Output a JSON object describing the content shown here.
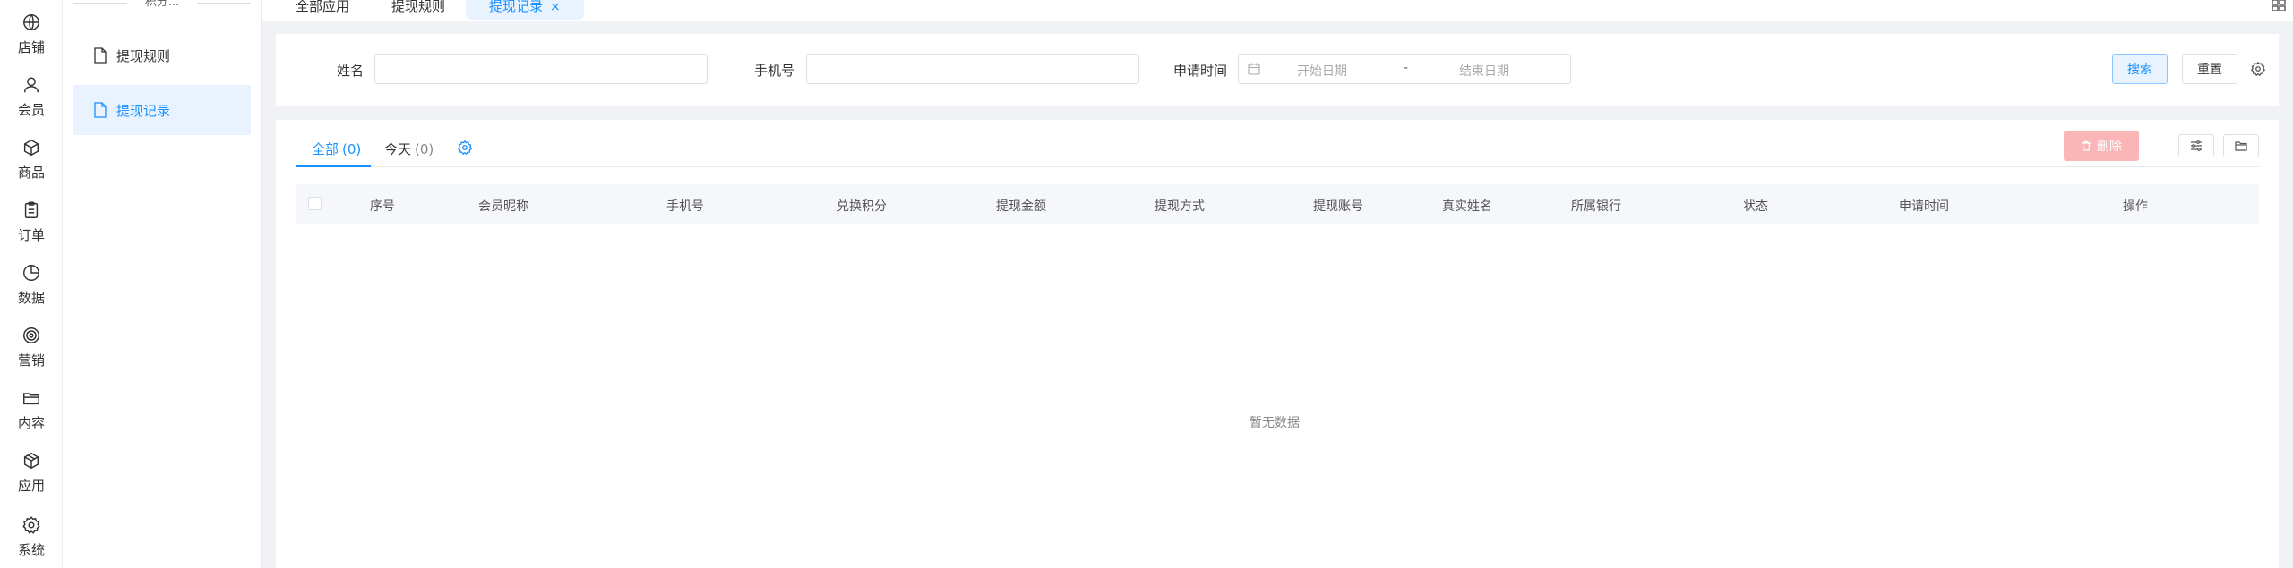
{
  "rail": {
    "items": [
      {
        "label": "店铺",
        "icon": "globe-icon"
      },
      {
        "label": "会员",
        "icon": "user-icon"
      },
      {
        "label": "商品",
        "icon": "cube-icon"
      },
      {
        "label": "订单",
        "icon": "clipboard-icon"
      },
      {
        "label": "数据",
        "icon": "pie-chart-icon"
      },
      {
        "label": "营销",
        "icon": "target-icon"
      },
      {
        "label": "内容",
        "icon": "folder-icon"
      },
      {
        "label": "应用",
        "icon": "box-icon"
      },
      {
        "label": "系统",
        "icon": "gear-icon"
      }
    ]
  },
  "submenu": {
    "heading": "积分...",
    "items": [
      {
        "label": "提现规则"
      },
      {
        "label": "提现记录"
      }
    ]
  },
  "tabs": [
    {
      "label": "全部应用"
    },
    {
      "label": "提现规则"
    },
    {
      "label": "提现记录"
    }
  ],
  "search": {
    "name_label": "姓名",
    "phone_label": "手机号",
    "time_label": "申请时间",
    "start_placeholder": "开始日期",
    "separator": "-",
    "end_placeholder": "结束日期",
    "search_btn": "搜索",
    "reset_btn": "重置"
  },
  "list": {
    "tabs": [
      {
        "label": "全部",
        "count": "(0)"
      },
      {
        "label": "今天",
        "count": "(0)"
      }
    ],
    "delete_btn": "删除",
    "columns": [
      "序号",
      "会员昵称",
      "手机号",
      "兑换积分",
      "提现金额",
      "提现方式",
      "提现账号",
      "真实姓名",
      "所属银行",
      "状态",
      "申请时间",
      "操作"
    ],
    "empty_text": "暂无数据"
  },
  "colors": {
    "accent": "#1890ff",
    "delete": "#fab6b6"
  }
}
